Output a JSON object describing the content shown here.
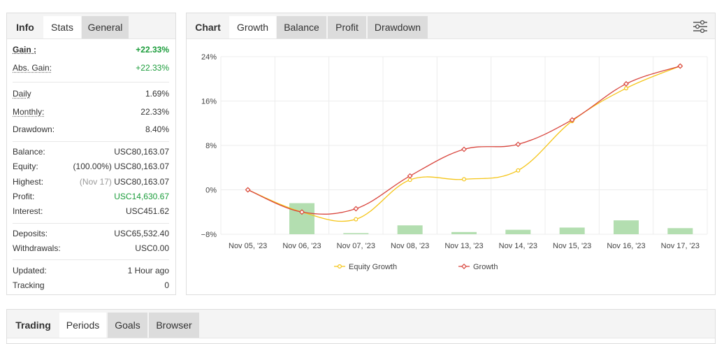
{
  "stats_tabs": [
    {
      "label": "Info"
    },
    {
      "label": "Stats"
    },
    {
      "label": "General"
    }
  ],
  "stats": {
    "gain": {
      "label": "Gain :",
      "value": "+22.33%"
    },
    "abs_gain": {
      "label": "Abs. Gain:",
      "value": "+22.33%"
    },
    "daily": {
      "label": "Daily",
      "value": "1.69%"
    },
    "monthly": {
      "label": "Monthly:",
      "value": "22.33%"
    },
    "drawdown": {
      "label": "Drawdown:",
      "value": "8.40%"
    },
    "balance": {
      "label": "Balance:",
      "value": "USC80,163.07"
    },
    "equity": {
      "label": "Equity:",
      "prefix": "(100.00%)",
      "value": "USC80,163.07"
    },
    "highest": {
      "label": "Highest:",
      "prefix": "(Nov 17)",
      "value": "USC80,163.07"
    },
    "profit": {
      "label": "Profit:",
      "value": "USC14,630.67"
    },
    "interest": {
      "label": "Interest:",
      "value": "USC451.62"
    },
    "deposits": {
      "label": "Deposits:",
      "value": "USC65,532.40"
    },
    "withdrawals": {
      "label": "Withdrawals:",
      "value": "USC0.00"
    },
    "updated": {
      "label": "Updated:",
      "value": "1 Hour ago"
    },
    "tracking": {
      "label": "Tracking",
      "value": "0"
    }
  },
  "chart_tabs": [
    {
      "label": "Chart"
    },
    {
      "label": "Growth"
    },
    {
      "label": "Balance"
    },
    {
      "label": "Profit"
    },
    {
      "label": "Drawdown"
    }
  ],
  "settings_icon": "sliders-icon",
  "colors": {
    "equity_growth": "#f5c518",
    "growth": "#d9473f",
    "bars": "#b3deb0",
    "positive": "#1a9c3a"
  },
  "chart_data": {
    "type": "line",
    "categories": [
      "Nov 05, '23",
      "Nov 06, '23",
      "Nov 07, '23",
      "Nov 08, '23",
      "Nov 13, '23",
      "Nov 14, '23",
      "Nov 15, '23",
      "Nov 16, '23",
      "Nov 17, '23"
    ],
    "yticks": [
      "24%",
      "16%",
      "8%",
      "0%",
      "−8%"
    ],
    "ylim": [
      -8,
      24
    ],
    "series": [
      {
        "name": "Equity Growth",
        "values": [
          0,
          -4.0,
          -5.3,
          1.8,
          1.9,
          3.5,
          12.4,
          18.3,
          22.3
        ]
      },
      {
        "name": "Growth",
        "values": [
          0,
          -4.0,
          -3.4,
          2.5,
          7.3,
          8.2,
          12.6,
          19.1,
          22.3
        ]
      }
    ],
    "bars": [
      0,
      5.6,
      0.2,
      1.6,
      0.4,
      0.8,
      1.2,
      2.5,
      1.1
    ],
    "legend_position": "bottom",
    "grid": true
  },
  "bottom_tabs": [
    {
      "label": "Trading"
    },
    {
      "label": "Periods"
    },
    {
      "label": "Goals"
    },
    {
      "label": "Browser"
    }
  ]
}
